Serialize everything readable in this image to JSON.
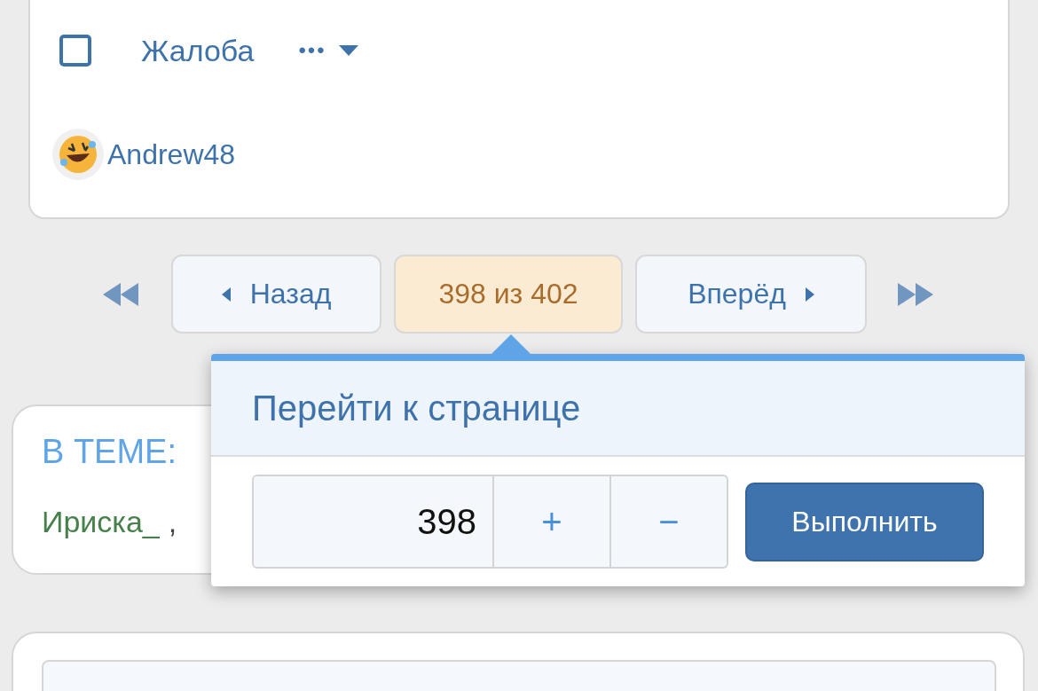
{
  "post_footer": {
    "select_checkbox": {
      "checked": false
    },
    "report_link": "Жалоба",
    "more_menu": "•••"
  },
  "reaction_user": "Andrew48",
  "pagination": {
    "back": "Назад",
    "current": "398 из 402",
    "next": "Вперёд"
  },
  "goto_popup": {
    "title": "Перейти к странице",
    "page_input": "398",
    "plus": "+",
    "minus": "−",
    "submit": "Выполнить"
  },
  "topic_card": {
    "heading": "В ТЕМЕ:",
    "users": [
      "Ириска_"
    ],
    "separator": ","
  }
}
